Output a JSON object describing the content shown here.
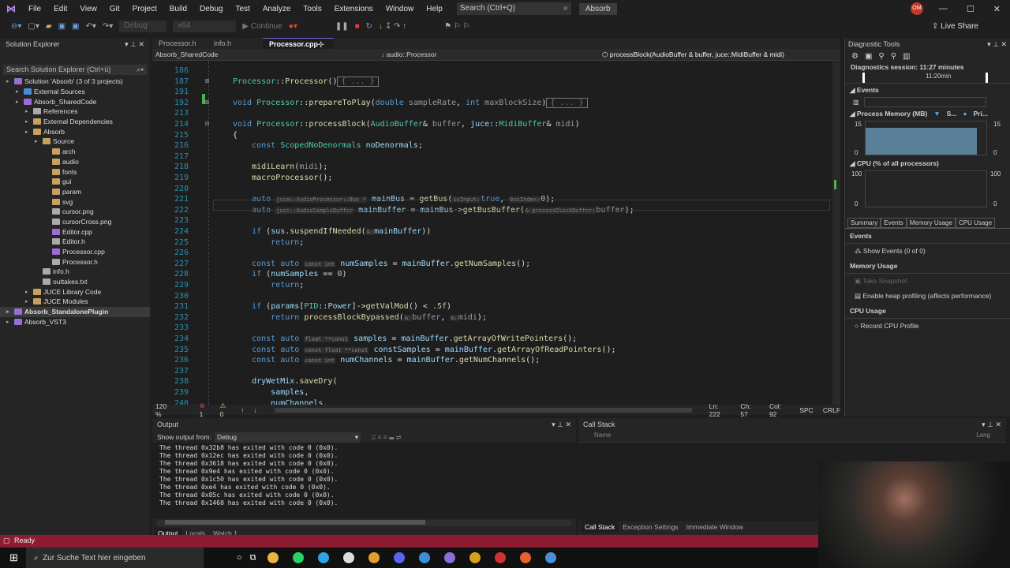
{
  "menu": {
    "items": [
      "File",
      "Edit",
      "View",
      "Git",
      "Project",
      "Build",
      "Debug",
      "Test",
      "Analyze",
      "Tools",
      "Extensions",
      "Window",
      "Help"
    ],
    "search": "Search (Ctrl+Q)",
    "project": "Absorb",
    "user_initials": "OM",
    "live_share": "Live Share"
  },
  "toolbar": {
    "config": "Debug",
    "platform": "x64",
    "continue": "Continue"
  },
  "solution_explorer": {
    "title": "Solution Explorer",
    "search": "Search Solution Explorer (Ctrl+ü)",
    "items": [
      {
        "label": "Solution 'Absorb' (3 of 3 projects)",
        "depth": 0,
        "color": "#9b6bd6"
      },
      {
        "label": "External Sources",
        "depth": 1,
        "color": "#4a8bd6"
      },
      {
        "label": "Absorb_SharedCode",
        "depth": 1,
        "color": "#9b6bd6"
      },
      {
        "label": "References",
        "depth": 2,
        "color": "#aaaaaa"
      },
      {
        "label": "External Dependencies",
        "depth": 2,
        "color": "#c8a060"
      },
      {
        "label": "Absorb",
        "depth": 2,
        "color": "#c8a060"
      },
      {
        "label": "Source",
        "depth": 3,
        "color": "#c8a060"
      },
      {
        "label": "arch",
        "depth": 4,
        "color": "#c8a060"
      },
      {
        "label": "audio",
        "depth": 4,
        "color": "#c8a060"
      },
      {
        "label": "fonts",
        "depth": 4,
        "color": "#c8a060"
      },
      {
        "label": "gui",
        "depth": 4,
        "color": "#c8a060"
      },
      {
        "label": "param",
        "depth": 4,
        "color": "#c8a060"
      },
      {
        "label": "svg",
        "depth": 4,
        "color": "#c8a060"
      },
      {
        "label": "cursor.png",
        "depth": 4,
        "color": "#aaaaaa"
      },
      {
        "label": "cursorCross.png",
        "depth": 4,
        "color": "#aaaaaa"
      },
      {
        "label": "Editor.cpp",
        "depth": 4,
        "color": "#9b6bd6"
      },
      {
        "label": "Editor.h",
        "depth": 4,
        "color": "#aaaaaa"
      },
      {
        "label": "Processor.cpp",
        "depth": 4,
        "color": "#9b6bd6"
      },
      {
        "label": "Processor.h",
        "depth": 4,
        "color": "#aaaaaa"
      },
      {
        "label": "info.h",
        "depth": 3,
        "color": "#aaaaaa"
      },
      {
        "label": "outtakes.txt",
        "depth": 3,
        "color": "#aaaaaa"
      },
      {
        "label": "JUCE Library Code",
        "depth": 2,
        "color": "#c8a060"
      },
      {
        "label": "JUCE Modules",
        "depth": 2,
        "color": "#c8a060"
      },
      {
        "label": "Absorb_StandalonePlugin",
        "depth": 0,
        "color": "#9b6bd6",
        "selected": true
      },
      {
        "label": "Absorb_VST3",
        "depth": 0,
        "color": "#9b6bd6"
      }
    ]
  },
  "editor": {
    "tabs": [
      "Processor.h",
      "info.h",
      "Processor.cpp"
    ],
    "active_tab": "Processor.cpp",
    "nav_project": "Absorb_SharedCode",
    "nav_scope": "audio::Processor",
    "nav_member": "processBlock(AudioBuffer & buffer, juce::MidiBuffer & midi)",
    "lines": [
      {
        "n": "186",
        "tokens": []
      },
      {
        "n": "187",
        "tokens": [
          [
            "t",
            "Processor"
          ],
          [
            "",
            "::"
          ],
          [
            "f",
            "Processor"
          ],
          [
            "",
            "()"
          ],
          [
            "c",
            "{ ... }"
          ]
        ]
      },
      {
        "n": "191",
        "tokens": []
      },
      {
        "n": "192",
        "tokens": [
          [
            "k",
            "void "
          ],
          [
            "t",
            "Processor"
          ],
          [
            "",
            "::"
          ],
          [
            "f",
            "prepareToPlay"
          ],
          [
            "",
            "("
          ],
          [
            "k",
            "double "
          ],
          [
            "g",
            "sampleRate"
          ],
          [
            "",
            ", "
          ],
          [
            "k",
            "int "
          ],
          [
            "g",
            "maxBlockSize"
          ],
          [
            "",
            ")"
          ],
          [
            "c",
            "{ ... }"
          ]
        ]
      },
      {
        "n": "213",
        "tokens": []
      },
      {
        "n": "214",
        "tokens": [
          [
            "k",
            "void "
          ],
          [
            "t",
            "Processor"
          ],
          [
            "",
            "::"
          ],
          [
            "f",
            "processBlock"
          ],
          [
            "",
            "("
          ],
          [
            "t",
            "AudioBuffer"
          ],
          [
            "",
            "& "
          ],
          [
            "g",
            "buffer"
          ],
          [
            "",
            ", "
          ],
          [
            "v",
            "juce"
          ],
          [
            "",
            "::"
          ],
          [
            "t",
            "MidiBuffer"
          ],
          [
            "",
            "& "
          ],
          [
            "g",
            "midi"
          ],
          [
            "",
            ")"
          ]
        ]
      },
      {
        "n": "215",
        "tokens": [
          [
            "",
            "{"
          ]
        ]
      },
      {
        "n": "216",
        "tokens": [
          [
            "",
            "    "
          ],
          [
            "k",
            "const "
          ],
          [
            "t",
            "ScopedNoDenormals "
          ],
          [
            "v",
            "noDenormals"
          ],
          [
            "",
            ";"
          ]
        ]
      },
      {
        "n": "217",
        "tokens": []
      },
      {
        "n": "218",
        "tokens": [
          [
            "",
            "    "
          ],
          [
            "f",
            "midiLearn"
          ],
          [
            "",
            "("
          ],
          [
            "g",
            "midi"
          ],
          [
            "",
            ");"
          ]
        ]
      },
      {
        "n": "219",
        "tokens": [
          [
            "",
            "    "
          ],
          [
            "f",
            "macroProcessor"
          ],
          [
            "",
            "();"
          ]
        ]
      },
      {
        "n": "220",
        "tokens": []
      },
      {
        "n": "221",
        "tokens": [
          [
            "",
            "    "
          ],
          [
            "k",
            "auto "
          ],
          [
            "h",
            "juce::AudioProcessor::Bus *"
          ],
          [
            "",
            " "
          ],
          [
            "v",
            "mainBus"
          ],
          [
            "",
            " = "
          ],
          [
            "f",
            "getBus"
          ],
          [
            "",
            "("
          ],
          [
            "h",
            "isInput:"
          ],
          [
            "k",
            "true"
          ],
          [
            "",
            ", "
          ],
          [
            "h",
            "busIndex:"
          ],
          [
            "n",
            "0"
          ],
          [
            "",
            ");"
          ]
        ]
      },
      {
        "n": "222",
        "tokens": [
          [
            "",
            "    "
          ],
          [
            "k",
            "auto "
          ],
          [
            "h",
            "juce::AudioSampleBuffer"
          ],
          [
            "",
            " "
          ],
          [
            "v",
            "mainBuffer"
          ],
          [
            "",
            " = "
          ],
          [
            "v",
            "mainBus"
          ],
          [
            "",
            "->"
          ],
          [
            "f",
            "getBusBuffer"
          ],
          [
            "",
            "("
          ],
          [
            "h",
            "& processBlockBuffer:"
          ],
          [
            "g",
            "buffer"
          ],
          [
            "",
            ");"
          ]
        ]
      },
      {
        "n": "223",
        "tokens": []
      },
      {
        "n": "224",
        "tokens": [
          [
            "",
            "    "
          ],
          [
            "k",
            "if "
          ],
          [
            "",
            "("
          ],
          [
            "v",
            "sus"
          ],
          [
            "",
            "."
          ],
          [
            "f",
            "suspendIfNeeded"
          ],
          [
            "",
            "("
          ],
          [
            "h",
            "&:"
          ],
          [
            "v",
            "mainBuffer"
          ],
          [
            "",
            "))"
          ]
        ]
      },
      {
        "n": "225",
        "tokens": [
          [
            "",
            "        "
          ],
          [
            "k",
            "return"
          ],
          [
            "",
            ";"
          ]
        ]
      },
      {
        "n": "226",
        "tokens": []
      },
      {
        "n": "227",
        "tokens": [
          [
            "",
            "    "
          ],
          [
            "k",
            "const auto "
          ],
          [
            "h",
            "const int"
          ],
          [
            "",
            " "
          ],
          [
            "v",
            "numSamples"
          ],
          [
            "",
            " = "
          ],
          [
            "v",
            "mainBuffer"
          ],
          [
            "",
            "."
          ],
          [
            "f",
            "getNumSamples"
          ],
          [
            "",
            "();"
          ]
        ]
      },
      {
        "n": "228",
        "tokens": [
          [
            "",
            "    "
          ],
          [
            "k",
            "if "
          ],
          [
            "",
            "("
          ],
          [
            "v",
            "numSamples"
          ],
          [
            "",
            " == "
          ],
          [
            "n",
            "0"
          ],
          [
            "",
            ")"
          ]
        ]
      },
      {
        "n": "229",
        "tokens": [
          [
            "",
            "        "
          ],
          [
            "k",
            "return"
          ],
          [
            "",
            ";"
          ]
        ]
      },
      {
        "n": "230",
        "tokens": []
      },
      {
        "n": "231",
        "tokens": [
          [
            "",
            "    "
          ],
          [
            "k",
            "if "
          ],
          [
            "",
            "("
          ],
          [
            "v",
            "params"
          ],
          [
            "",
            "["
          ],
          [
            "t",
            "PID"
          ],
          [
            "",
            "::"
          ],
          [
            "v",
            "Power"
          ],
          [
            "",
            "]->"
          ],
          [
            "f",
            "getValMod"
          ],
          [
            "",
            "() < "
          ],
          [
            "n",
            ".5f"
          ],
          [
            "",
            ")"
          ]
        ]
      },
      {
        "n": "232",
        "tokens": [
          [
            "",
            "        "
          ],
          [
            "k",
            "return "
          ],
          [
            "f",
            "processBlockBypassed"
          ],
          [
            "",
            "("
          ],
          [
            "h",
            "&:"
          ],
          [
            "g",
            "buffer"
          ],
          [
            "",
            ", "
          ],
          [
            "h",
            "&:"
          ],
          [
            "g",
            "midi"
          ],
          [
            "",
            ");"
          ]
        ]
      },
      {
        "n": "233",
        "tokens": []
      },
      {
        "n": "234",
        "tokens": [
          [
            "",
            "    "
          ],
          [
            "k",
            "const auto "
          ],
          [
            "h",
            "float **const"
          ],
          [
            "",
            " "
          ],
          [
            "v",
            "samples"
          ],
          [
            "",
            " = "
          ],
          [
            "v",
            "mainBuffer"
          ],
          [
            "",
            "."
          ],
          [
            "f",
            "getArrayOfWritePointers"
          ],
          [
            "",
            "();"
          ]
        ]
      },
      {
        "n": "235",
        "tokens": [
          [
            "",
            "    "
          ],
          [
            "k",
            "const auto "
          ],
          [
            "h",
            "const float **const"
          ],
          [
            "",
            " "
          ],
          [
            "v",
            "constSamples"
          ],
          [
            "",
            " = "
          ],
          [
            "v",
            "mainBuffer"
          ],
          [
            "",
            "."
          ],
          [
            "f",
            "getArrayOfReadPointers"
          ],
          [
            "",
            "();"
          ]
        ]
      },
      {
        "n": "236",
        "tokens": [
          [
            "",
            "    "
          ],
          [
            "k",
            "const auto "
          ],
          [
            "h",
            "const int"
          ],
          [
            "",
            " "
          ],
          [
            "v",
            "numChannels"
          ],
          [
            "",
            " = "
          ],
          [
            "v",
            "mainBuffer"
          ],
          [
            "",
            "."
          ],
          [
            "f",
            "getNumChannels"
          ],
          [
            "",
            "();"
          ]
        ]
      },
      {
        "n": "237",
        "tokens": []
      },
      {
        "n": "238",
        "tokens": [
          [
            "",
            "    "
          ],
          [
            "v",
            "dryWetMix"
          ],
          [
            "",
            "."
          ],
          [
            "f",
            "saveDry"
          ],
          [
            "",
            "("
          ]
        ]
      },
      {
        "n": "239",
        "tokens": [
          [
            "",
            "        "
          ],
          [
            "v",
            "samples"
          ],
          [
            "",
            ","
          ]
        ]
      },
      {
        "n": "240",
        "tokens": [
          [
            "",
            "        "
          ],
          [
            "v",
            "numChannels"
          ],
          [
            "",
            ","
          ]
        ]
      }
    ],
    "status": {
      "zoom": "120 %",
      "errors": "1",
      "warnings": "0",
      "ln": "Ln: 222",
      "ch": "Ch: 57",
      "col": "Col: 92",
      "spc": "SPC",
      "eol": "CRLF"
    }
  },
  "diagnostics": {
    "title": "Diagnostic Tools",
    "session": "Diagnostics session: 11:27 minutes",
    "timeline_label": "11:20min",
    "events_label": "Events",
    "memory_label": "Process Memory (MB)",
    "memory_legend": [
      "S...",
      "Pri..."
    ],
    "memory_max": "15",
    "memory_min": "0",
    "memory_fill": 0.8,
    "cpu_label": "CPU (% of all processors)",
    "cpu_max": "100",
    "cpu_min": "0",
    "tabs": [
      "Summary",
      "Events",
      "Memory Usage",
      "CPU Usage"
    ],
    "sections": {
      "events": "Events",
      "show_events": "Show Events (0 of 0)",
      "memory": "Memory Usage",
      "snapshot": "Take Snapshot",
      "heap": "Enable heap profiling (affects performance)",
      "cpu": "CPU Usage",
      "record": "Record CPU Profile"
    }
  },
  "output": {
    "title": "Output",
    "show_from_label": "Show output from:",
    "source": "Debug",
    "lines": [
      "The thread 0x32b8 has exited with code 0 (0x0).",
      "The thread 0x12ec has exited with code 0 (0x0).",
      "The thread 0x3618 has exited with code 0 (0x0).",
      "The thread 0x9e4 has exited with code 0 (0x0).",
      "The thread 0x1c50 has exited with code 0 (0x0).",
      "The thread 0xe4 has exited with code 0 (0x0).",
      "The thread 0x85c has exited with code 0 (0x0).",
      "The thread 0x1460 has exited with code 0 (0x0)."
    ],
    "tabs": [
      "Output",
      "Locals",
      "Watch 1"
    ]
  },
  "callstack": {
    "title": "Call Stack",
    "col_name": "Name",
    "col_lang": "Lang",
    "tabs": [
      "Call Stack",
      "Exception Settings",
      "Immediate Window"
    ]
  },
  "statusbar": {
    "text": "Ready"
  },
  "taskbar": {
    "search": "Zur Suche Text hier eingeben",
    "apps": [
      "#e8b640",
      "#25d366",
      "#2ca5e0",
      "#dddddd",
      "#e0a030",
      "#5865f2",
      "#3b8fd6",
      "#8b6fd8",
      "#d4a020",
      "#cc3333",
      "#e8602c",
      "#4a90d9"
    ]
  }
}
